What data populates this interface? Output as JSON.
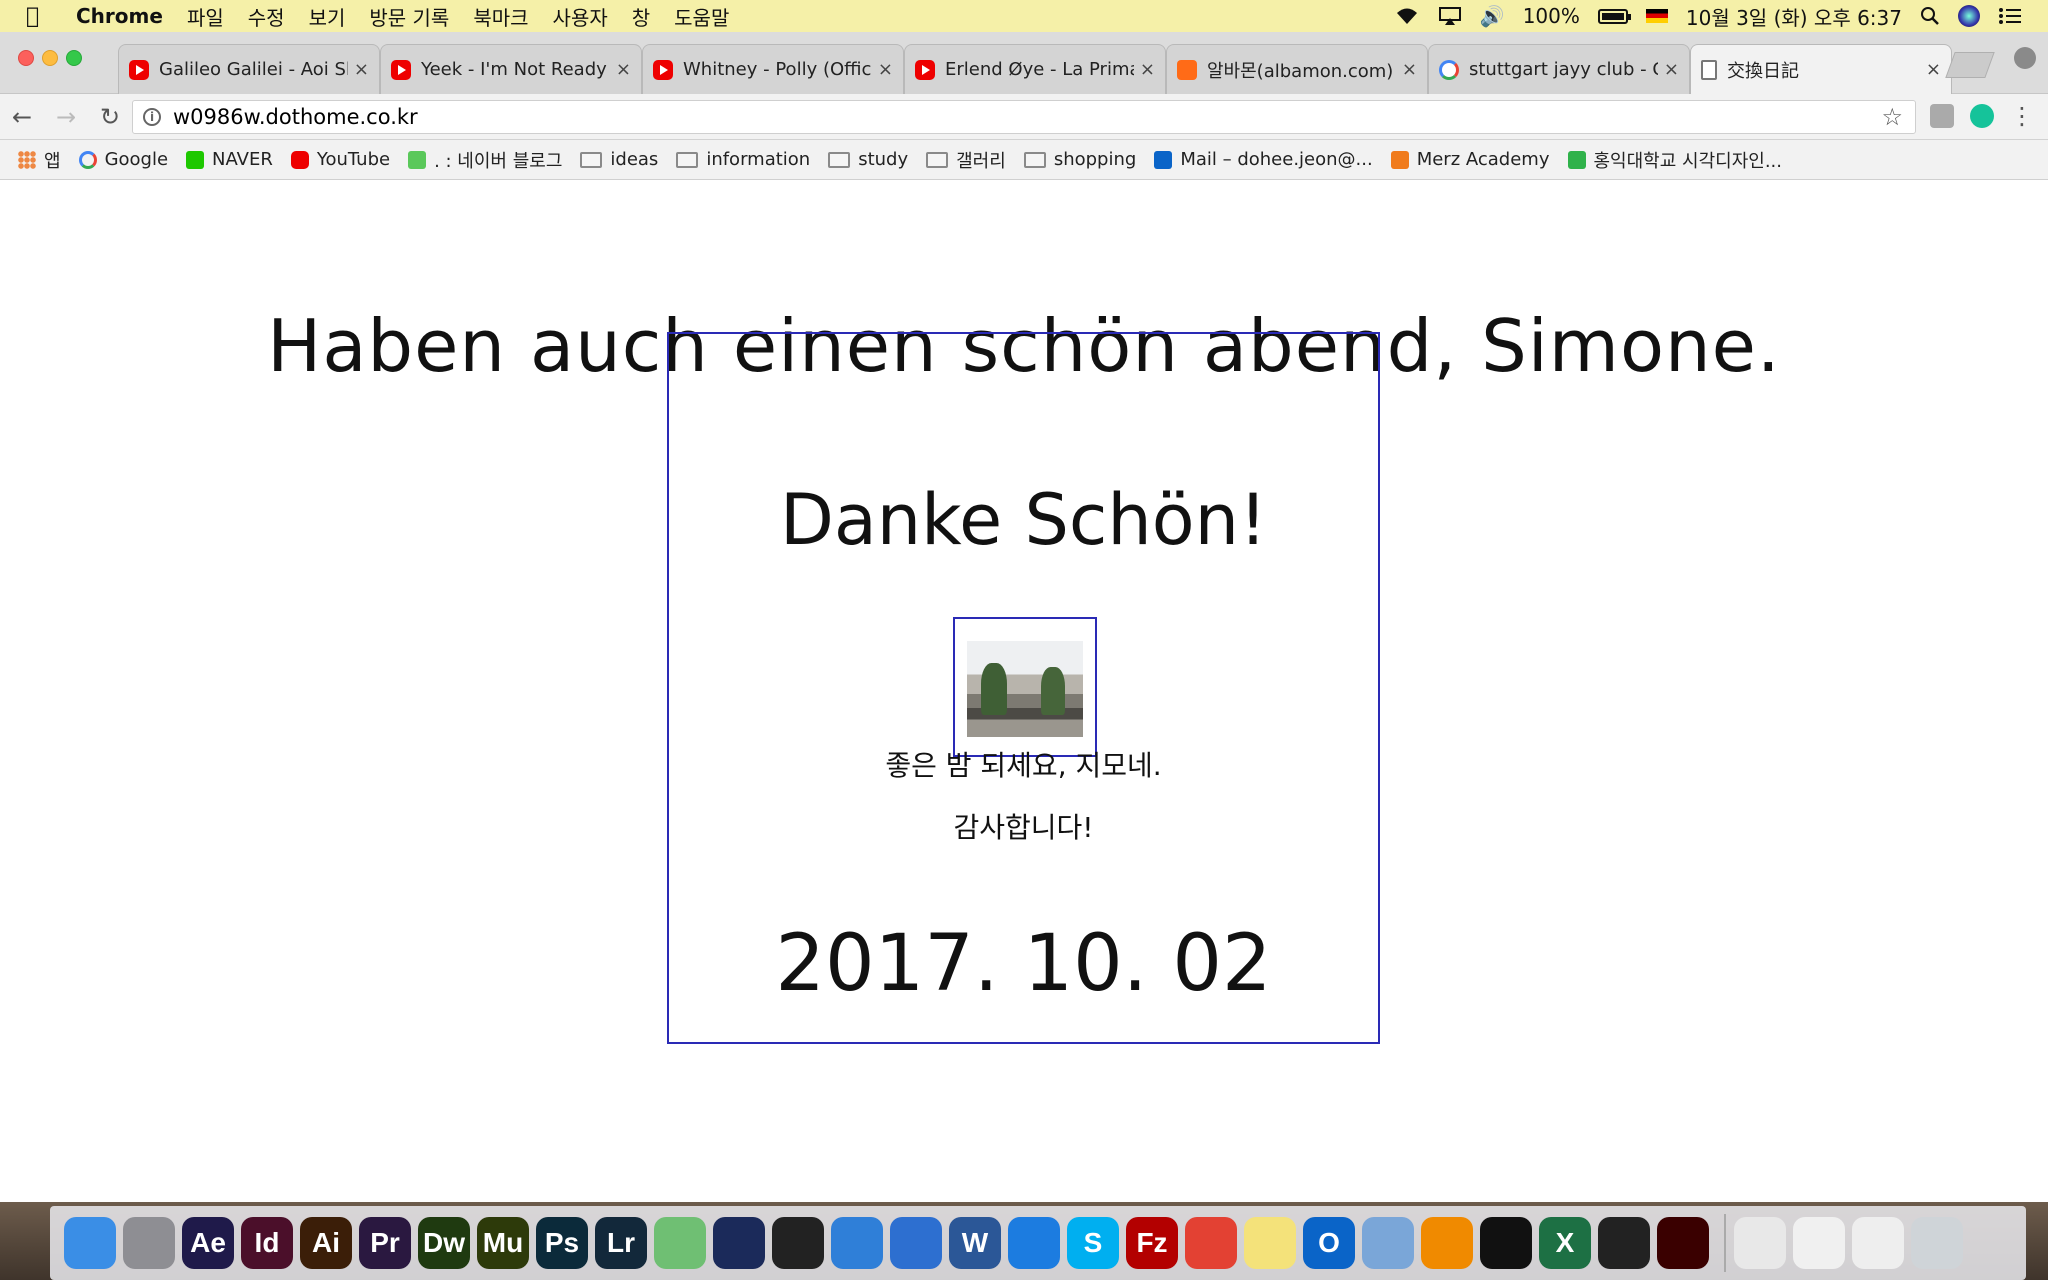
{
  "menubar": {
    "app_name": "Chrome",
    "items": [
      "파일",
      "수정",
      "보기",
      "방문 기록",
      "북마크",
      "사용자",
      "창",
      "도움말"
    ],
    "battery": "100%",
    "datetime": "10월 3일 (화) 오후 6:37"
  },
  "tabs": [
    {
      "title": "Galileo Galilei - Aoi Shi",
      "favicon": "youtube-icon",
      "close": "×"
    },
    {
      "title": "Yeek - I'm Not Ready (",
      "favicon": "youtube-icon",
      "close": "×"
    },
    {
      "title": "Whitney - Polly (Officia",
      "favicon": "youtube-icon",
      "close": "×"
    },
    {
      "title": "Erlend Øye - La Prima E",
      "favicon": "youtube-icon",
      "close": "×"
    },
    {
      "title": "알바몬(albamon.com) |",
      "favicon": "albamon-icon",
      "close": "×"
    },
    {
      "title": "stuttgart jayy club - Go",
      "favicon": "google-icon",
      "close": "×"
    },
    {
      "title": "交換日記",
      "favicon": "document-icon",
      "close": "×"
    }
  ],
  "address_bar": {
    "url": "w0986w.dothome.co.kr"
  },
  "bookmarks": [
    {
      "label": "앱",
      "icon": "apps-grid-icon"
    },
    {
      "label": "Google",
      "icon": "google-icon"
    },
    {
      "label": "NAVER",
      "icon": "naver-icon"
    },
    {
      "label": "YouTube",
      "icon": "youtube-icon"
    },
    {
      "label": ". : 네이버 블로그",
      "icon": "blog-icon"
    },
    {
      "label": "ideas",
      "icon": "folder-icon"
    },
    {
      "label": "information",
      "icon": "folder-icon"
    },
    {
      "label": "study",
      "icon": "folder-icon"
    },
    {
      "label": "갤러리",
      "icon": "folder-icon"
    },
    {
      "label": "shopping",
      "icon": "folder-icon"
    },
    {
      "label": "Mail – dohee.jeon@...",
      "icon": "outlook-icon"
    },
    {
      "label": "Merz Academy",
      "icon": "merz-icon"
    },
    {
      "label": "홍익대학교 시각디자인...",
      "icon": "hongik-icon"
    }
  ],
  "page": {
    "headline": "Haben auch einen schön abend, Simone.",
    "thanks_de": "Danke Schön!",
    "line_ko1": "좋은 밤 되세요, 지모네.",
    "line_ko2": "감사합니다!",
    "date": "2017. 10. 02"
  },
  "dock": {
    "apps": [
      {
        "name": "finder-icon",
        "label": "",
        "color": "#3a8ee6"
      },
      {
        "name": "launchpad-icon",
        "label": "",
        "color": "#8e8e93"
      },
      {
        "name": "after-effects-icon",
        "label": "Ae",
        "color": "#1f1a4a"
      },
      {
        "name": "indesign-icon",
        "label": "Id",
        "color": "#4b0f2a"
      },
      {
        "name": "illustrator-icon",
        "label": "Ai",
        "color": "#3b1e08"
      },
      {
        "name": "premiere-icon",
        "label": "Pr",
        "color": "#2a1840"
      },
      {
        "name": "dreamweaver-icon",
        "label": "Dw",
        "color": "#1f3a10"
      },
      {
        "name": "muse-icon",
        "label": "Mu",
        "color": "#2d3a0a"
      },
      {
        "name": "photoshop-icon",
        "label": "Ps",
        "color": "#0b2a3a"
      },
      {
        "name": "lightroom-icon",
        "label": "Lr",
        "color": "#12283a"
      },
      {
        "name": "atom-icon",
        "label": "",
        "color": "#6fbf73"
      },
      {
        "name": "cinema4d-icon",
        "label": "",
        "color": "#1b2a5a"
      },
      {
        "name": "pixelmator-icon",
        "label": "",
        "color": "#222222"
      },
      {
        "name": "sketch-icon",
        "label": "",
        "color": "#2f7fd8"
      },
      {
        "name": "documents-icon",
        "label": "",
        "color": "#2d6fd0"
      },
      {
        "name": "word-icon",
        "label": "W",
        "color": "#2b5797"
      },
      {
        "name": "safari-icon",
        "label": "",
        "color": "#1c7ce0"
      },
      {
        "name": "skype-icon",
        "label": "S",
        "color": "#00aff0"
      },
      {
        "name": "filezilla-icon",
        "label": "Fz",
        "color": "#b30000"
      },
      {
        "name": "chrome-icon",
        "label": "",
        "color": "#e34133"
      },
      {
        "name": "notes-icon",
        "label": "",
        "color": "#f4e27a"
      },
      {
        "name": "outlook-icon",
        "label": "O",
        "color": "#0a64c8"
      },
      {
        "name": "preview-icon",
        "label": "",
        "color": "#7aa6d8"
      },
      {
        "name": "vlc-icon",
        "label": "",
        "color": "#f08a00"
      },
      {
        "name": "exec-icon",
        "label": "",
        "color": "#111111"
      },
      {
        "name": "excel-icon",
        "label": "X",
        "color": "#1d7044"
      },
      {
        "name": "terminal-icon",
        "label": "",
        "color": "#222222"
      },
      {
        "name": "acrobat-icon",
        "label": "",
        "color": "#3a0000"
      },
      {
        "name": "excel-doc-icon",
        "label": "",
        "color": "#e8e8e8"
      },
      {
        "name": "file-doc-icon",
        "label": "",
        "color": "#f0f0f0"
      },
      {
        "name": "pdf-doc-icon",
        "label": "",
        "color": "#eeeeee"
      },
      {
        "name": "trash-icon",
        "label": "",
        "color": "#cfd4d8"
      }
    ]
  }
}
